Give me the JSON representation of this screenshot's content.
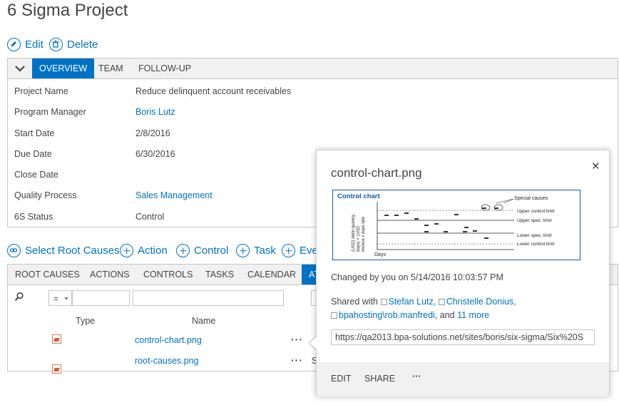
{
  "page_title": "6 Sigma Project",
  "item_actions": {
    "edit_label": "Edit",
    "delete_label": "Delete"
  },
  "form_tabs": [
    "OVERVIEW",
    "TEAM",
    "FOLLOW-UP"
  ],
  "form_fields": [
    {
      "label": "Project Name",
      "value": "Reduce delinquent account receivables",
      "is_link": false
    },
    {
      "label": "Program Manager",
      "value": "Boris Lutz",
      "is_link": true
    },
    {
      "label": "Start Date",
      "value": "2/8/2016",
      "is_link": false
    },
    {
      "label": "Due Date",
      "value": "6/30/2016",
      "is_link": false
    },
    {
      "label": "Close Date",
      "value": "",
      "is_link": false
    },
    {
      "label": "Quality Process",
      "value": "Sales Management",
      "is_link": true
    },
    {
      "label": "6S Status",
      "value": "Control",
      "is_link": false
    }
  ],
  "commands": [
    "Select Root Causes",
    "Action",
    "Control",
    "Task",
    "Eve"
  ],
  "library_tabs": [
    "ROOT CAUSES",
    "ACTIONS",
    "CONTROLS",
    "TASKS",
    "CALENDAR",
    "AT"
  ],
  "filter": {
    "operator": "="
  },
  "list_columns": {
    "type": "Type",
    "name": "Name"
  },
  "files": [
    {
      "name": "control-chart.png",
      "ellipsis": "···",
      "trailing": ""
    },
    {
      "name": "root-causes.png",
      "ellipsis": "···",
      "trailing": "S"
    }
  ],
  "callout": {
    "title": "control-chart.png",
    "changed": "Changed by you on 5/14/2016 10:03:57 PM",
    "shared_prefix": "Shared with",
    "shared_users": [
      "Stefan Lutz,",
      "Christelle Donius,",
      "bpahosting\\rob.manfredi"
    ],
    "shared_and": ", and",
    "shared_more": "11 more",
    "url": "https://qa2013.bpa-solutions.net/sites/boris/six-sigma/Six%20S",
    "actions": {
      "edit": "EDIT",
      "share": "SHARE",
      "more": "···"
    },
    "close_glyph": "✕"
  },
  "thumbnail": {
    "title": "Control chart",
    "special": "Special causes",
    "ylabel_lines": [
      "(USD) delin quency",
      "days) = (USD",
      "invoice x days late"
    ],
    "xlabel": "Days",
    "limits": [
      "Upper control limit",
      "Upper spec. limit",
      "Lower spec. limit",
      "Lower control limit"
    ]
  },
  "colors": {
    "accent": "#0072c6",
    "text": "#444444",
    "border": "#c6c6c6",
    "bar_bg": "#f1f1f1"
  }
}
